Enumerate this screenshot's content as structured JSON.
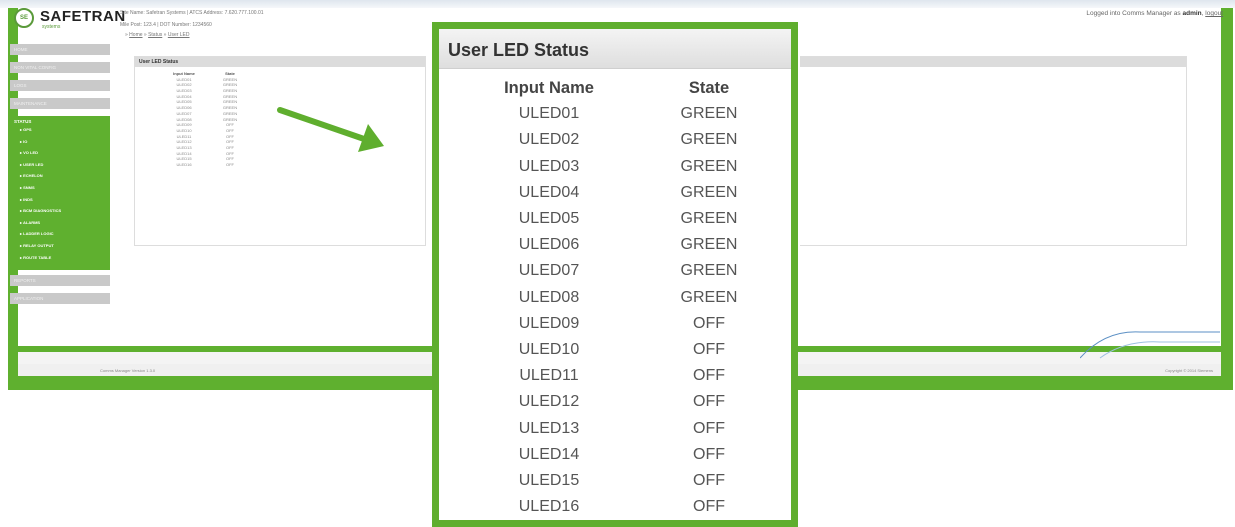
{
  "header": {
    "logo_badge": "SE",
    "brand": "SAFETRAN",
    "brand_sub": "systems",
    "site_info": "Site Name: Safetran Systems  |  ATCS Address: 7.620.777.100.01",
    "mile_info": "Mile Post:  123.4          |  DOT Number:  1234560",
    "breadcrumb": [
      "Home",
      "Status",
      "User LED"
    ],
    "login_prefix": "Logged into Comms Manager as",
    "login_user": "admin",
    "logout_label": "logout"
  },
  "sidebar": {
    "items_top": [
      "HOME",
      "NON VITAL CONFIG",
      "LOGS",
      "MAINTENANCE"
    ],
    "status_label": "STATUS",
    "status_items": [
      "GPS",
      "IO",
      "VO LED",
      "USER LED",
      "ECHELON",
      "SNMS",
      "INDS",
      "BCM DIAGNOSTICS",
      "ALARMS",
      "LADDER LOGIC",
      "RELAY OUTPUT",
      "ROUTE TABLE"
    ],
    "items_bottom": [
      "REPORTS",
      "APPLICATION"
    ]
  },
  "mini_panel": {
    "title": "User LED Status",
    "col_input": "Input Name",
    "col_state": "State"
  },
  "footer": {
    "version": "Comms Manager Version 1.3.0",
    "copyright": "Copyright © 2014 Siemens"
  },
  "callout": {
    "title": "User LED Status",
    "col_input": "Input Name",
    "col_state": "State",
    "rows": [
      {
        "name": "ULED01",
        "state": "GREEN"
      },
      {
        "name": "ULED02",
        "state": "GREEN"
      },
      {
        "name": "ULED03",
        "state": "GREEN"
      },
      {
        "name": "ULED04",
        "state": "GREEN"
      },
      {
        "name": "ULED05",
        "state": "GREEN"
      },
      {
        "name": "ULED06",
        "state": "GREEN"
      },
      {
        "name": "ULED07",
        "state": "GREEN"
      },
      {
        "name": "ULED08",
        "state": "GREEN"
      },
      {
        "name": "ULED09",
        "state": "OFF"
      },
      {
        "name": "ULED10",
        "state": "OFF"
      },
      {
        "name": "ULED11",
        "state": "OFF"
      },
      {
        "name": "ULED12",
        "state": "OFF"
      },
      {
        "name": "ULED13",
        "state": "OFF"
      },
      {
        "name": "ULED14",
        "state": "OFF"
      },
      {
        "name": "ULED15",
        "state": "OFF"
      },
      {
        "name": "ULED16",
        "state": "OFF"
      }
    ]
  },
  "colors": {
    "accent_green": "#5fae2e",
    "sidebar_grey": "#c9c9c9"
  }
}
